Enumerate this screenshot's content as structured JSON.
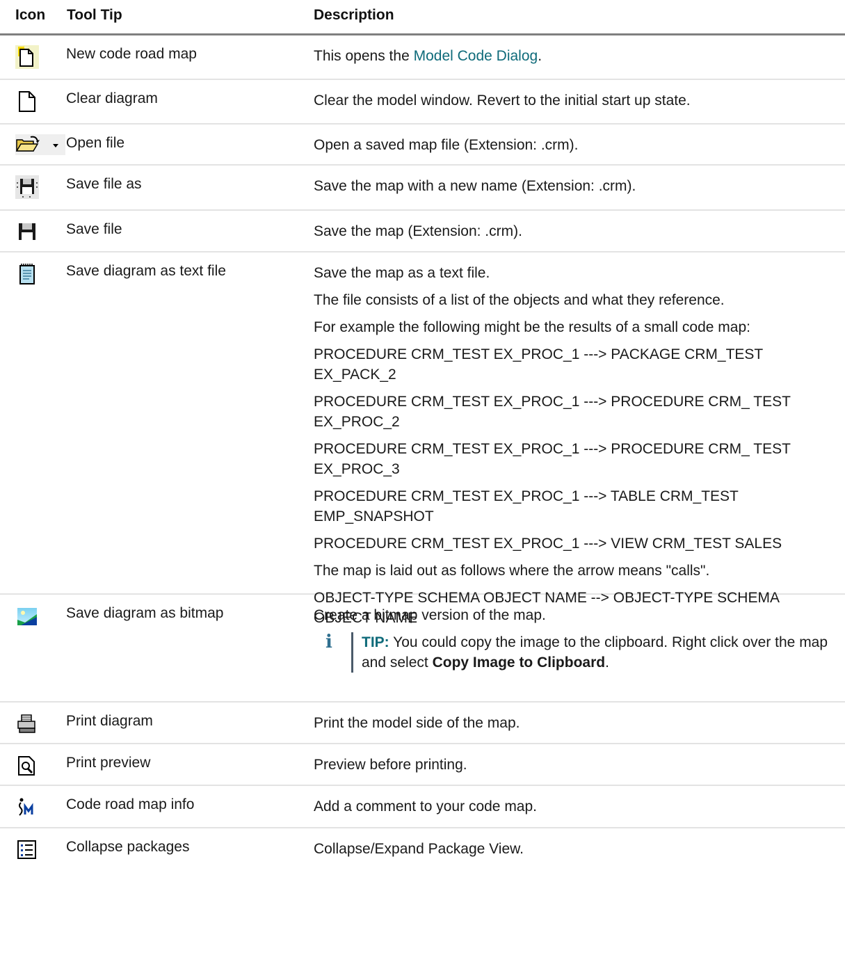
{
  "header": {
    "icon": "Icon",
    "tool_tip": "Tool Tip",
    "description": "Description"
  },
  "rows": [
    {
      "icon": "new-code-road-map-icon",
      "tip": "New code road map",
      "desc_prefix": "This opens the ",
      "desc_link": "Model Code Dialog",
      "desc_suffix": "."
    },
    {
      "icon": "clear-diagram-icon",
      "tip": "Clear diagram",
      "desc": "Clear the model window. Revert to the initial start up state."
    },
    {
      "icon": "open-file-icon",
      "tip": "Open file",
      "desc": "Open a saved map file (Extension: .crm)."
    },
    {
      "icon": "save-file-as-icon",
      "tip": "Save file as",
      "desc": "Save the map with a new name (Extension: .crm)."
    },
    {
      "icon": "save-file-icon",
      "tip": "Save file",
      "desc": "Save the map (Extension: .crm)."
    },
    {
      "icon": "save-as-text-icon",
      "tip": "Save diagram as text file",
      "paragraphs": [
        "Save the map as a text file.",
        "The file consists of a list of the objects and what they reference.",
        "For example the following might be the results of a small code map:",
        "PROCEDURE CRM_TEST EX_PROC_1 ---> PACKAGE CRM_TEST EX_PACK_2",
        "PROCEDURE CRM_TEST EX_PROC_1 ---> PROCEDURE CRM_ TEST EX_PROC_2",
        "PROCEDURE CRM_TEST EX_PROC_1 ---> PROCEDURE CRM_ TEST EX_PROC_3",
        "PROCEDURE CRM_TEST EX_PROC_1 ---> TABLE CRM_TEST EMP_SNAPSHOT",
        "PROCEDURE CRM_TEST EX_PROC_1 ---> VIEW CRM_TEST SALES",
        "The map is laid out as follows where the arrow means \"calls\".",
        "OBJECT-TYPE SCHEMA OBJECT NAME --> OBJECT-TYPE SCHEMA OBJECT NAME"
      ]
    },
    {
      "icon": "save-as-bitmap-icon",
      "tip": "Save diagram as bitmap",
      "desc": "Create a bitmap version of the map.",
      "tip_note": {
        "icon": "info-icon",
        "glyph": "i",
        "label": "TIP:",
        "text": " You could copy the image to the clipboard. Right click over the map and select ",
        "bold": "Copy Image to Clipboard",
        "end": "."
      }
    },
    {
      "icon": "printer-icon",
      "tip": "Print diagram",
      "desc": "Print the model side of the map."
    },
    {
      "icon": "print-preview-icon",
      "tip": "Print preview",
      "desc": "Preview before printing."
    },
    {
      "icon": "code-road-map-info-icon",
      "tip": "Code road map info",
      "desc": "Add a comment to your code map."
    },
    {
      "icon": "collapse-packages-icon",
      "tip": "Collapse packages",
      "desc": "Collapse/Expand Package View."
    }
  ]
}
